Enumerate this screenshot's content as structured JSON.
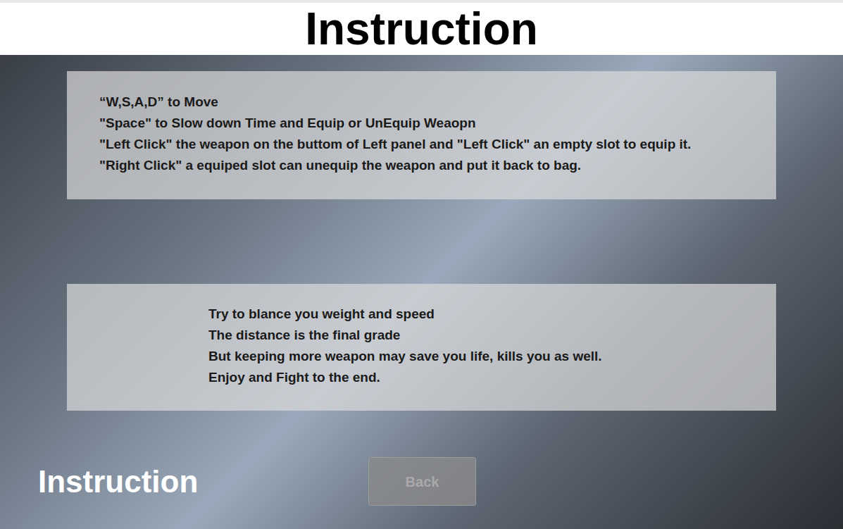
{
  "header": {
    "title": "Instruction"
  },
  "controls_panel": {
    "lines": [
      "“W,S,A,D” to Move",
      "\"Space\" to Slow down Time and Equip or UnEquip Weaopn",
      "\"Left Click\" the weapon on the buttom of Left panel and \"Left Click\" an empty slot to equip it.",
      "\"Right Click\" a equiped slot can unequip the weapon and put it back to bag."
    ]
  },
  "tips_panel": {
    "lines": [
      "Try to blance you weight and speed",
      "The distance is the final grade",
      "But keeping more weapon may save you life, kills you as well.",
      "Enjoy and Fight to the end."
    ]
  },
  "footer": {
    "label": "Instruction",
    "back_button": "Back"
  }
}
